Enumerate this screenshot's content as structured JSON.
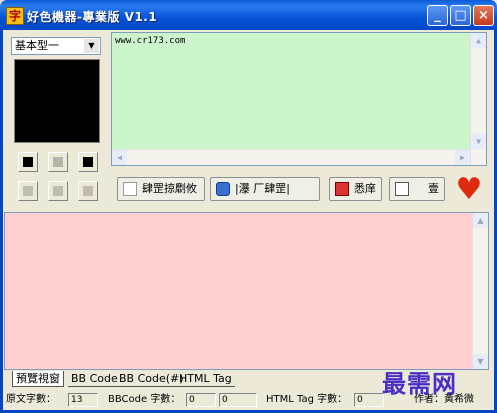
{
  "window": {
    "title": "好色機器-專業版  V1.1",
    "controls": {
      "minimize": "_",
      "maximize": "□",
      "close": "×"
    }
  },
  "left_panel": {
    "type_select": "基本型一",
    "preview_color": "#000000",
    "color_buttons": [
      {
        "name": "black",
        "color": "#000000"
      },
      {
        "name": "gray",
        "color": "#b8b5a8"
      },
      {
        "name": "black2",
        "color": "#000000"
      },
      {
        "name": "gray2",
        "color": "#c0bdb0"
      },
      {
        "name": "gray3",
        "color": "#c0bdb0"
      },
      {
        "name": "gray4",
        "color": "#c0bdb0"
      }
    ]
  },
  "input_area": {
    "text": "www.cr173.com",
    "background": "#ccf5cc"
  },
  "toolbar": {
    "button1": "肆罡掠劘攸",
    "button2": "|瀑  厂肆罡|",
    "button3": "悉庠",
    "button4": "壹"
  },
  "output_area": {
    "background": "#ffcece"
  },
  "tabs": [
    "預覽視窗",
    "BB Code",
    "BB Code(#)",
    "HTML Tag"
  ],
  "watermark": "最需网",
  "status": {
    "orig_label": "原文字數：",
    "orig_value": "13",
    "bb_label": "BBCode 字數：",
    "bb_value": "0",
    "bb_value2": "0",
    "html_label": "HTML Tag 字數：",
    "html_value": "0",
    "author": "作者：黃希微"
  }
}
